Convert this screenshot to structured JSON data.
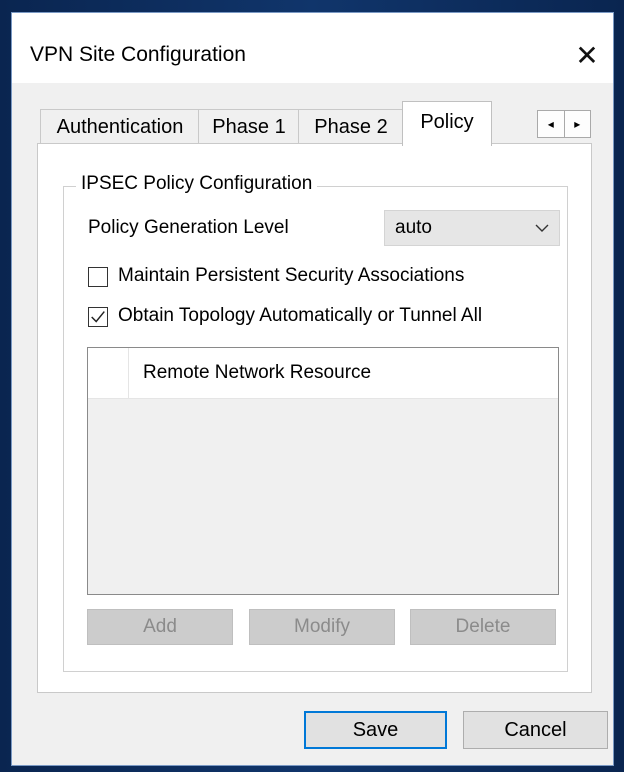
{
  "window": {
    "title": "VPN Site Configuration",
    "close_glyph": "✕"
  },
  "tabs": [
    {
      "label": "Authentication"
    },
    {
      "label": "Phase 1"
    },
    {
      "label": "Phase 2"
    },
    {
      "label": "Policy",
      "active": true
    }
  ],
  "tab_scroll": {
    "left": "◂",
    "right": "▸"
  },
  "policy": {
    "group_title": "IPSEC Policy Configuration",
    "generation_level_label": "Policy Generation Level",
    "generation_level_value": "auto",
    "maintain_sa_label": "Maintain Persistent Security Associations",
    "maintain_sa_checked": false,
    "obtain_topology_label": "Obtain Topology Automatically or Tunnel All",
    "obtain_topology_checked": true,
    "resource_list": {
      "column_header": "Remote Network Resource",
      "rows": []
    },
    "buttons": {
      "add": "Add",
      "modify": "Modify",
      "delete": "Delete"
    }
  },
  "footer": {
    "save": "Save",
    "cancel": "Cancel"
  },
  "colors": {
    "accent": "#0078d7",
    "desktop": "#0b2a55",
    "disabled_text": "#8b8b8b"
  }
}
